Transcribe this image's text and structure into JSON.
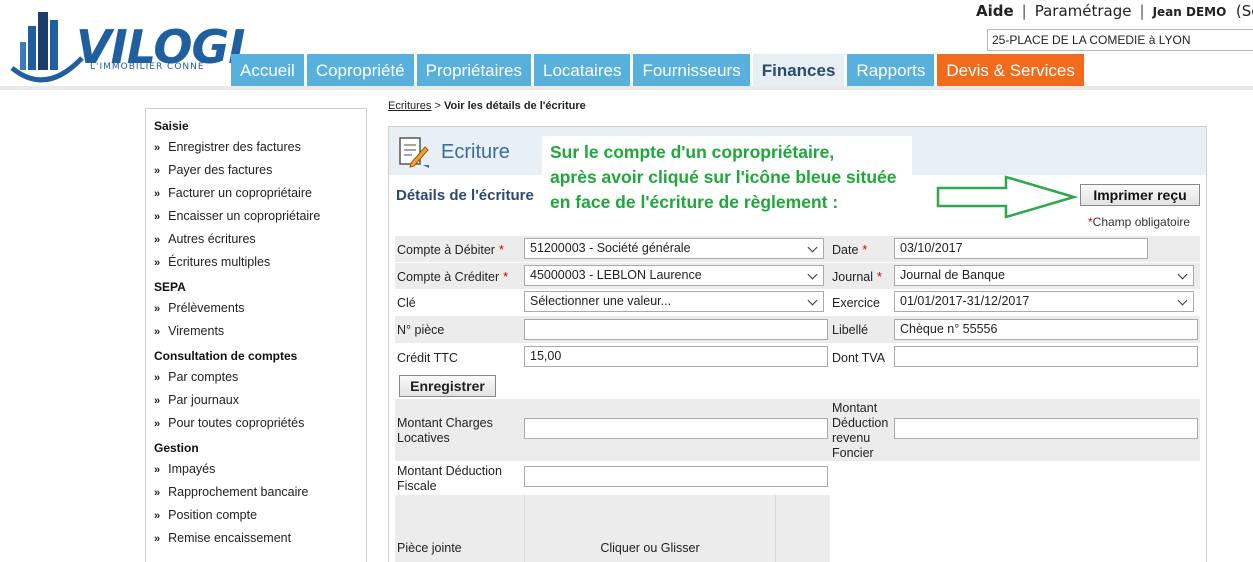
{
  "header": {
    "logo_text": "VILOGI",
    "logo_tagline": "L'IMMOBILIER CONNE",
    "links": {
      "aide": "Aide",
      "parametrage": "Paramétrage",
      "user": "Jean DEMO",
      "trailing": "(Se"
    },
    "building": "25-PLACE DE LA COMEDIE à LYON",
    "tabs": [
      "Accueil",
      "Copropriété",
      "Propriétaires",
      "Locataires",
      "Fournisseurs",
      "Finances",
      "Rapports",
      "Devis & Services"
    ],
    "active_tab": "Finances"
  },
  "sidebar": {
    "sections": [
      {
        "title": "Saisie",
        "items": [
          "Enregistrer des factures",
          "Payer des factures",
          "Facturer un copropriétaire",
          "Encaisser un copropriétaire",
          "Autres écritures",
          "Écritures multiples"
        ]
      },
      {
        "title": "SEPA",
        "items": [
          "Prélèvements",
          "Virements"
        ]
      },
      {
        "title": "Consultation de comptes",
        "items": [
          "Par comptes",
          "Par journaux",
          "Pour toutes copropriétés"
        ]
      },
      {
        "title": "Gestion",
        "items": [
          "Impayés",
          "Rapprochement bancaire",
          "Position compte",
          "Remise encaissement"
        ]
      }
    ]
  },
  "breadcrumb": {
    "link": "Ecritures",
    "separator": " > ",
    "current": "Voir les détails de l'écriture"
  },
  "panel": {
    "title": "Ecriture",
    "details_title": "Détails de l'écriture",
    "print_button": "Imprimer reçu",
    "required_note": "Champ obligatoire",
    "annotation": [
      "Sur le compte d'un copropriétaire,",
      "après avoir cliqué sur l'icône bleue située",
      "en face de l'écriture de règlement :"
    ]
  },
  "form": {
    "compte_debiter": {
      "label": "Compte à Débiter",
      "value": "51200003 - Société générale"
    },
    "compte_crediter": {
      "label": "Compte à Créditer",
      "value": "45000003 - LEBLON Laurence"
    },
    "cle": {
      "label": "Clé",
      "value": "Sélectionner une valeur..."
    },
    "num_piece": {
      "label": "N° pièce",
      "value": ""
    },
    "credit_ttc": {
      "label": "Crédit TTC",
      "value": "15,00"
    },
    "date": {
      "label": "Date",
      "value": "03/10/2017"
    },
    "journal": {
      "label": "Journal",
      "value": "Journal de Banque"
    },
    "exercice": {
      "label": "Exercice",
      "value": "01/01/2017-31/12/2017"
    },
    "libelle": {
      "label": "Libellé",
      "value": "Chèque n° 55556"
    },
    "dont_tva": {
      "label": "Dont TVA",
      "value": ""
    },
    "save_button": "Enregistrer",
    "charges_locatives": {
      "label_1": "Montant Charges",
      "label_2": "Locatives",
      "value": ""
    },
    "deduction_revenu": {
      "label_1": "Montant",
      "label_2": "Déduction",
      "label_3": "revenu",
      "label_4": "Foncier",
      "value": ""
    },
    "deduction_fiscale": {
      "label_1": "Montant Déduction",
      "label_2": "Fiscale",
      "value": ""
    },
    "piece_jointe": {
      "label": "Pièce jointe",
      "dropzone": "Cliquer ou Glisser"
    }
  }
}
